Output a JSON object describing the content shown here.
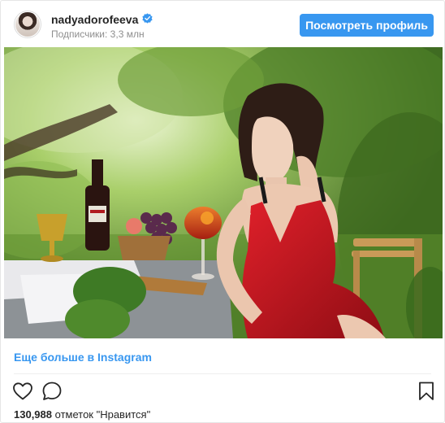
{
  "header": {
    "username": "nadyadorofeeva",
    "followers_text": "Подписчики: 3,3 млн",
    "view_profile_label": "Посмотреть профиль",
    "accent_color": "#3897f0"
  },
  "post": {
    "image_alt": "",
    "more_link": "Еще больше в Instagram",
    "likes_count": "130,988",
    "likes_suffix": "отметок \"Нравится\""
  },
  "icons": [
    "verified-badge-icon",
    "heart-icon",
    "comment-icon",
    "bookmark-icon"
  ]
}
